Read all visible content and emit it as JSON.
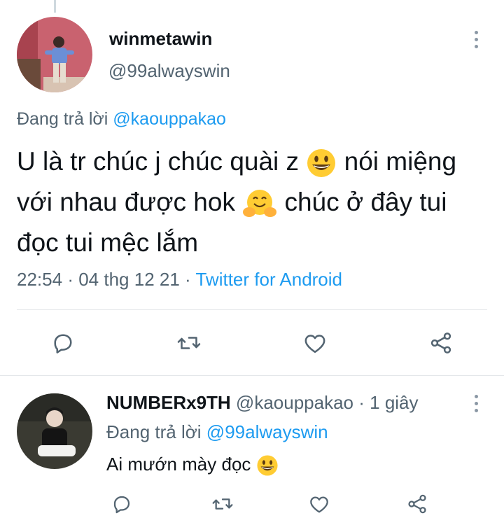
{
  "tweet": {
    "display_name": "winmetawin",
    "handle": "@99alwayswin",
    "replying_label": "Đang trả lời",
    "replying_to": "@kaouppakao",
    "text_part1": "U là tr chúc j chúc quài z",
    "text_part2": "nói miệng với nhau được hok",
    "text_part3": "chúc ở đây tui đọc tui mệc lắm",
    "emoji1": "grinning-face-emoji",
    "emoji2": "hugging-face-emoji",
    "time": "22:54",
    "date": "04 thg 12 21",
    "source": "Twitter for Android",
    "actions": [
      "reply-icon",
      "retweet-icon",
      "like-icon",
      "share-icon"
    ]
  },
  "reply": {
    "display_name": "NUMBERx9TH",
    "handle": "@kaouppakao",
    "dot": "·",
    "time": "1 giây",
    "replying_label": "Đang trả lời",
    "replying_to": "@99alwayswin",
    "text": "Ai mướn mày đọc",
    "emoji": "grinning-face-emoji",
    "actions": [
      "reply-icon",
      "retweet-icon",
      "like-icon",
      "share-icon"
    ]
  },
  "colors": {
    "link": "#1d9bf0",
    "secondary_text": "#536471",
    "primary_text": "#0f1419",
    "icon": "#536471",
    "divider": "#e4e7ea"
  }
}
